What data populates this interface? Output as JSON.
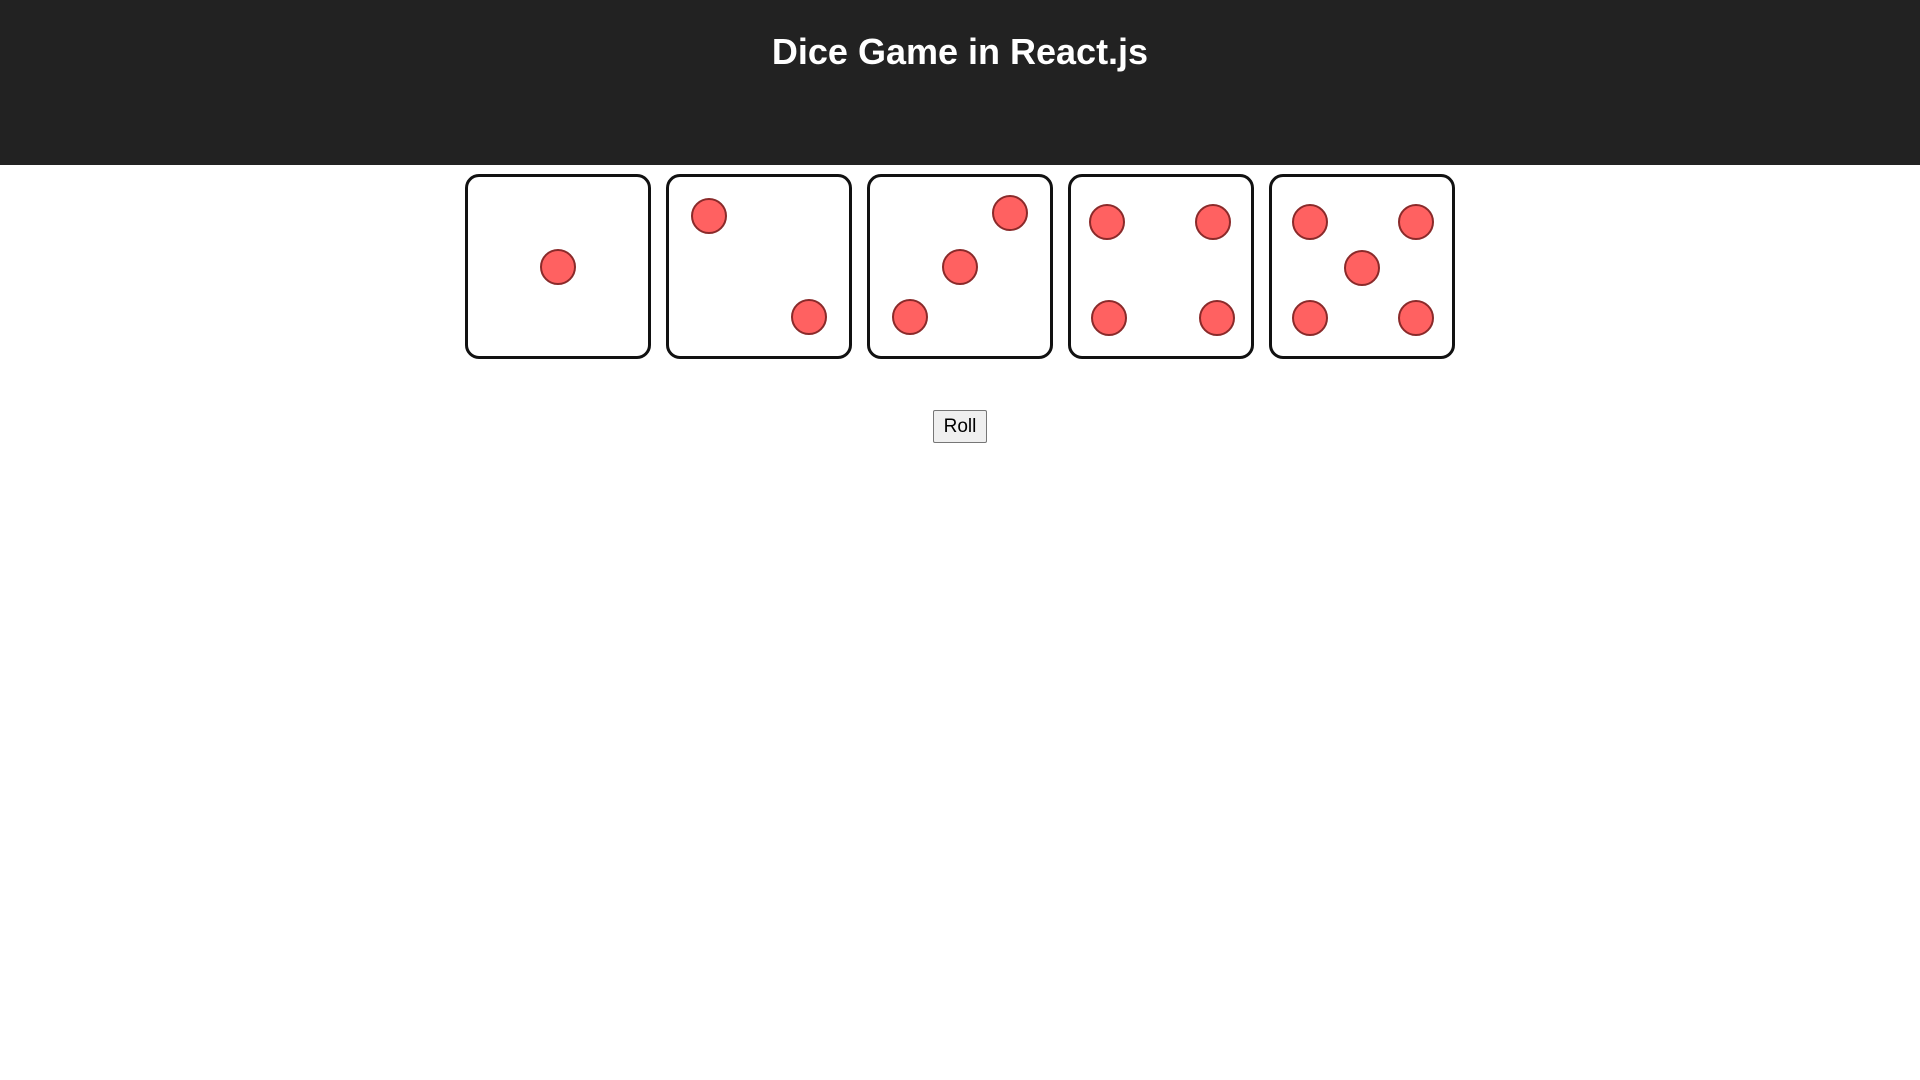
{
  "header": {
    "title": "Dice Game in React.js",
    "background_color": "#222222",
    "title_color": "#ffffff"
  },
  "dice": [
    {
      "value": 1
    },
    {
      "value": 2
    },
    {
      "value": 3
    },
    {
      "value": 4
    },
    {
      "value": 5
    }
  ],
  "pip_color": "#ff6161",
  "controls": {
    "roll_label": "Roll"
  }
}
